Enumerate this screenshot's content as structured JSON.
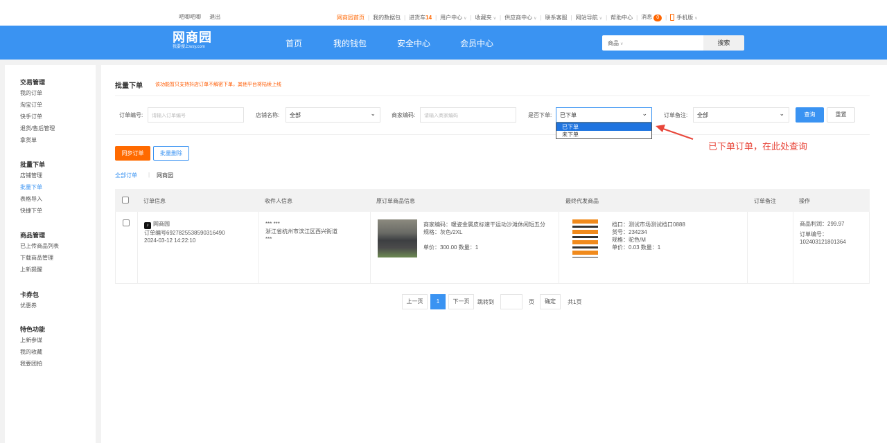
{
  "topbar": {
    "user": "吧唧吧唧",
    "logout": "退出",
    "links": [
      {
        "label": "网商园首页",
        "highlight": true
      },
      {
        "label": "我的数据包"
      },
      {
        "label": "进货车",
        "count": "14"
      },
      {
        "label": "用户中心",
        "dropdown": true
      },
      {
        "label": "收藏夹",
        "dropdown": true
      },
      {
        "label": "供应商中心",
        "dropdown": true
      },
      {
        "label": "联系客服"
      },
      {
        "label": "网站导航",
        "dropdown": true
      },
      {
        "label": "帮助中心"
      },
      {
        "label": "消息",
        "badge": "0"
      },
      {
        "label": "手机版",
        "dropdown": true
      }
    ]
  },
  "header": {
    "logo_main": "网商园",
    "logo_sub": "我要搜上wsy.com",
    "nav": [
      "首页",
      "我的钱包",
      "安全中心",
      "会员中心"
    ],
    "search_scope": "商品",
    "search_button": "搜索"
  },
  "sidebar": {
    "groups": [
      {
        "title": "交易管理",
        "items": [
          "我的订单",
          "淘宝订单",
          "快手订单",
          "退货/售后管理",
          "拿货单"
        ]
      },
      {
        "title": "批量下单",
        "items": [
          "店铺管理",
          "批量下单",
          "表格导入",
          "快捷下单"
        ],
        "active": "批量下单"
      },
      {
        "title": "商品管理",
        "items": [
          "已上传商品列表",
          "下载商品管理",
          "上新提醒"
        ]
      },
      {
        "title": "卡券包",
        "items": [
          "优惠券"
        ]
      },
      {
        "title": "特色功能",
        "items": [
          "上新参谋",
          "我的收藏",
          "我要团拍"
        ]
      }
    ]
  },
  "page": {
    "title": "批量下单",
    "tip": "该功能暂只支持抖店订单不解密下单，其他平台将陆续上线"
  },
  "filters": {
    "order_no_label": "订单编号:",
    "order_no_placeholder": "请输入订单编号",
    "shop_label": "店铺名称:",
    "shop_value": "全部",
    "merchant_code_label": "商家编码:",
    "merchant_code_placeholder": "请输入商家编码",
    "ordered_label": "是否下单:",
    "ordered_value": "已下单",
    "ordered_options": [
      "已下单",
      "未下单"
    ],
    "remark_label": "订单备注:",
    "remark_value": "全部",
    "query_button": "查询",
    "reset_button": "重置"
  },
  "annotation": "已下单订单，在此处查询",
  "colors": {
    "accent": "#3a93f2",
    "orange": "#ff6a00",
    "annotation": "#e8463a"
  },
  "actions": {
    "sync_button": "同步订单",
    "batch_delete_button": "批量删除"
  },
  "subtabs": {
    "all": "全部订单",
    "sep": "|",
    "site": "网商园"
  },
  "table": {
    "headers": [
      "订单信息",
      "收件人信息",
      "原订单商品信息",
      "最终代发商品",
      "订单备注",
      "操作"
    ],
    "rows": [
      {
        "platform": "网商园",
        "order_no": "订单编号6927825538590316490",
        "time": "2024-03-12 14:22:10",
        "recipient_name": "*** ***",
        "recipient_addr": "浙江省杭州市滨江区西兴街道",
        "recipient_extra": "***",
        "orig_code": "商家编码：暖姿金属皮标速干运动沙滩休闲短五分",
        "orig_spec": "规格：灰色/2XL",
        "orig_price": "单价：300.00 数量：1",
        "final_stall": "档口：测试市场测试档口0888",
        "final_sku": "货号：234234",
        "final_spec": "规格：驼色/M",
        "final_price": "单价：0.03 数量：1",
        "remark": "",
        "profit": "商品利润：299.97",
        "op_order_label": "订单编号：",
        "op_order_no": "102403121801364"
      }
    ]
  },
  "pagination": {
    "prev": "上一页",
    "current": "1",
    "next": "下一页",
    "jump_label": "跳转到",
    "page_unit": "页",
    "confirm": "确定",
    "total": "共1页"
  }
}
